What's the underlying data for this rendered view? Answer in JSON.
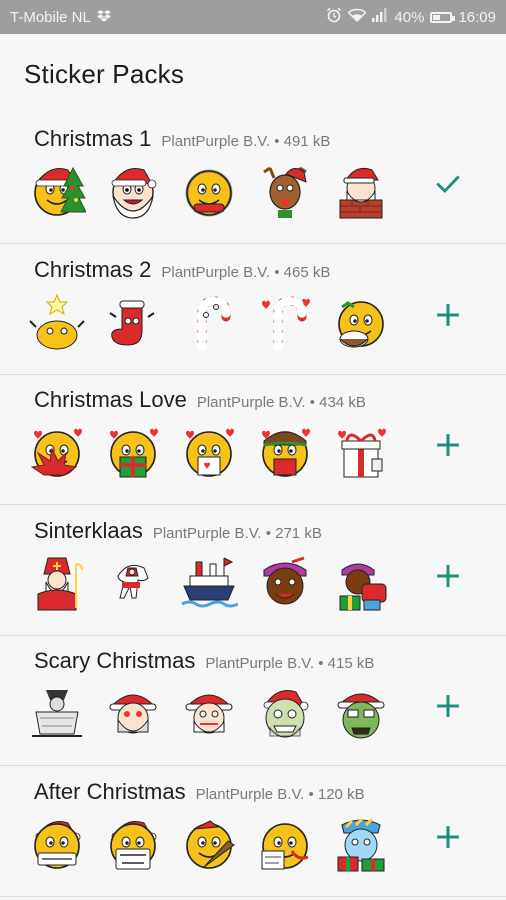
{
  "status_bar": {
    "carrier": "T-Mobile NL",
    "battery": "40%",
    "time": "16:09"
  },
  "app_bar": {
    "title": "Sticker Packs"
  },
  "packs": [
    {
      "name": "Christmas 1",
      "publisher": "PlantPurple B.V.",
      "size": "491 kB",
      "action": "added-check-icon",
      "stickers": [
        "smiley-with-tree",
        "santa-face",
        "smiley-with-scarf",
        "reindeer",
        "santa-in-chimney"
      ]
    },
    {
      "name": "Christmas 2",
      "publisher": "PlantPurple B.V.",
      "size": "465 kB",
      "action": "add-plus-icon",
      "stickers": [
        "smiley-with-star",
        "red-stocking",
        "candy-cane",
        "candy-cane-love",
        "smiley-with-bowl"
      ]
    },
    {
      "name": "Christmas Love",
      "publisher": "PlantPurple B.V.",
      "size": "434 kB",
      "action": "add-plus-icon",
      "stickers": [
        "smiley-with-poinsettia",
        "smiley-with-gift",
        "smiley-with-love-card",
        "smiley-elf-love",
        "gift-box"
      ]
    },
    {
      "name": "Sinterklaas",
      "publisher": "PlantPurple B.V.",
      "size": "271 kB",
      "action": "add-plus-icon",
      "stickers": [
        "sinterklaas",
        "white-horse",
        "steamboat",
        "piet-face",
        "piet-with-presents"
      ]
    },
    {
      "name": "Scary Christmas",
      "publisher": "PlantPurple B.V.",
      "size": "415 kB",
      "action": "add-plus-icon",
      "stickers": [
        "grim-sled",
        "zombie-santa",
        "zombie-santa-2",
        "zombie-face",
        "green-zombie"
      ]
    },
    {
      "name": "After Christmas",
      "publisher": "PlantPurple B.V.",
      "size": "120 kB",
      "action": "add-plus-icon",
      "stickers": [
        "smiley-overate",
        "smiley-its-over",
        "smiley-with-tree-down",
        "smiley-too-much",
        "frozen-smiley-gifts"
      ]
    }
  ],
  "colors": {
    "accent": "#1e8f7c",
    "status_bar": "#9e9e9e",
    "background": "#f7f7f7"
  }
}
